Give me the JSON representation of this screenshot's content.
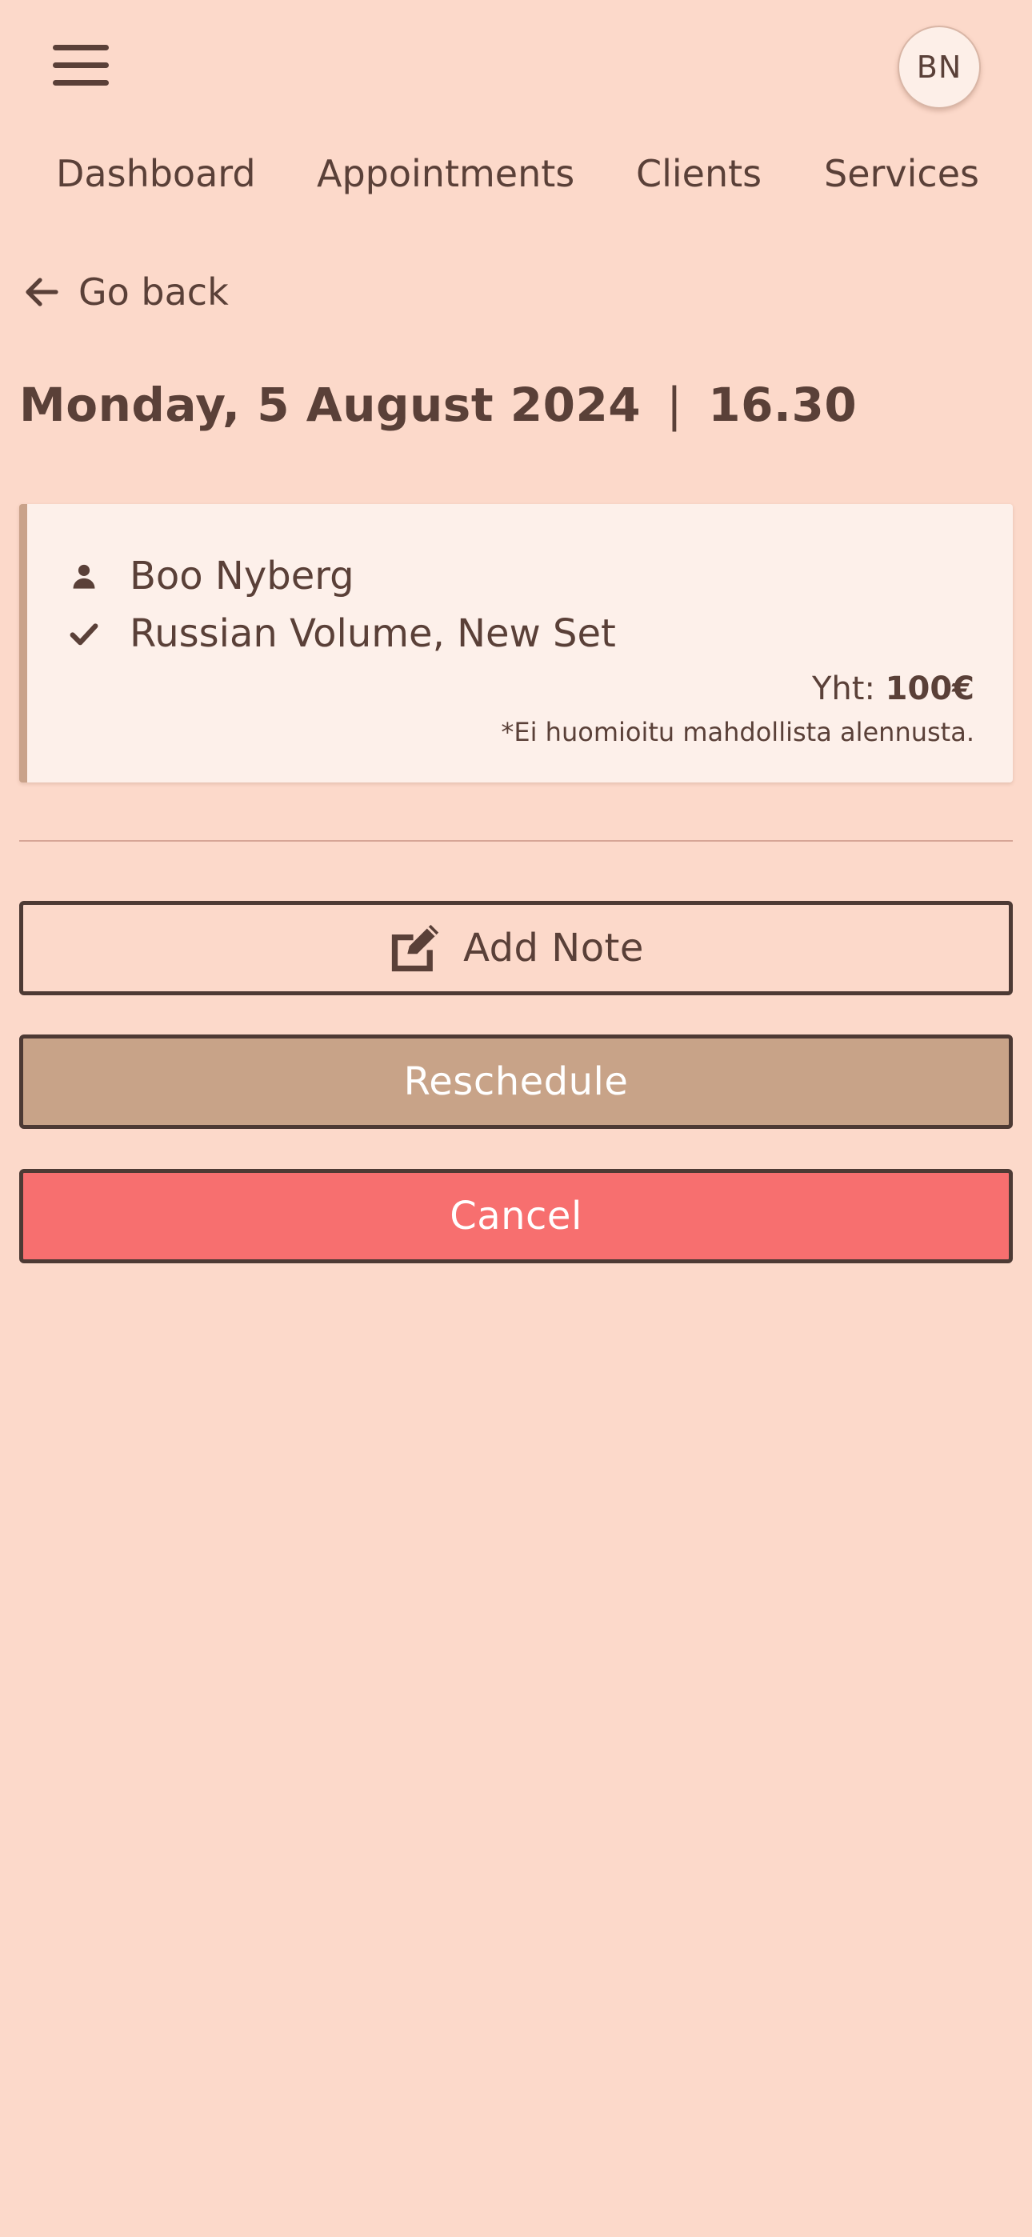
{
  "header": {
    "avatar_initials": "BN"
  },
  "nav": {
    "items": [
      {
        "label": "Dashboard"
      },
      {
        "label": "Appointments"
      },
      {
        "label": "Clients"
      },
      {
        "label": "Services"
      }
    ]
  },
  "go_back": {
    "label": "Go back"
  },
  "appointment": {
    "date": "Monday, 5 August 2024",
    "separator": "|",
    "time": "16.30",
    "client_name": "Boo Nyberg",
    "service": "Russian Volume, New Set",
    "total_label": "Yht:",
    "total_value": "100€",
    "disclaimer": "*Ei huomioitu mahdollista alennusta."
  },
  "actions": {
    "add_note_label": "Add Note",
    "reschedule_label": "Reschedule",
    "cancel_label": "Cancel"
  },
  "icons": {
    "menu": "hamburger-menu-icon",
    "back": "arrow-left-icon",
    "client": "user-icon",
    "service": "checkmark-icon",
    "note": "edit-icon"
  },
  "colors": {
    "background": "#fcd9ca",
    "text": "#5a4038",
    "card": "#fdf0ea",
    "card_accent": "#c9a28a",
    "reschedule": "#c8a388",
    "cancel": "#f76f6f"
  }
}
